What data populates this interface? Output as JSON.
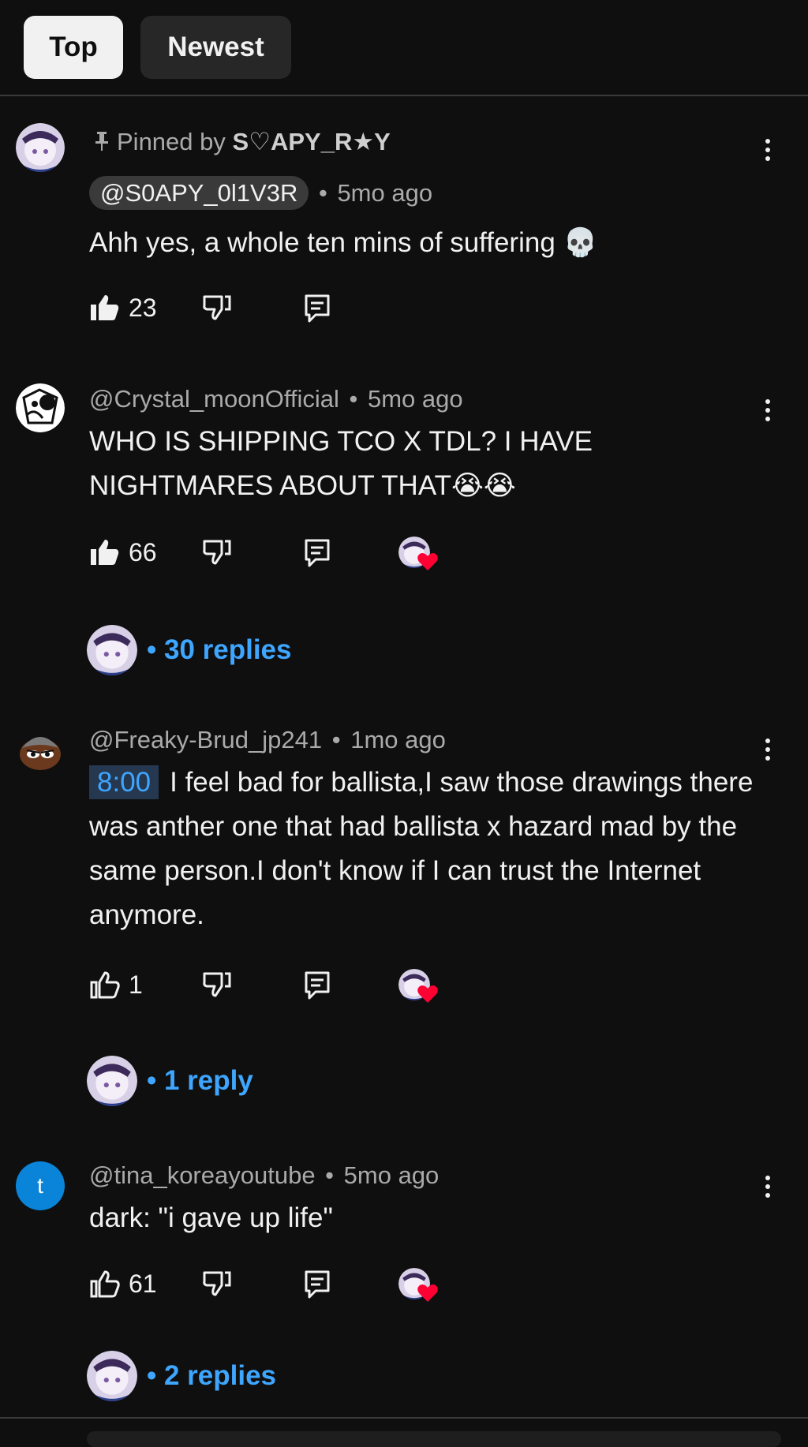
{
  "sort": {
    "top_label": "Top",
    "newest_label": "Newest"
  },
  "comments": [
    {
      "pinned_text": "Pinned by",
      "pinned_by": "S♡APY_R★Y",
      "author": "@S0APY_0l1V3R",
      "time": "5mo ago",
      "text": "Ahh yes, a whole ten mins of suffering 💀",
      "likes": "23"
    },
    {
      "author": "@Crystal_moonOfficial",
      "time": "5mo ago",
      "text": "WHO IS SHIPPING TCO X TDL? I HAVE NIGHTMARES ABOUT THAT😭😭",
      "likes": "66",
      "replies": "30 replies"
    },
    {
      "author": "@Freaky-Brud_jp241",
      "time": "1mo ago",
      "timestamp": "8:00",
      "text": "I feel bad for ballista,I saw those drawings there was anther one that had ballista x hazard mad by the same person.I don't know if I can trust the Internet anymore.",
      "likes": "1",
      "replies": "1 reply"
    },
    {
      "author": "@tina_koreayoutube",
      "avatar_letter": "t",
      "time": "5mo ago",
      "text": "dark: \"i gave up life\"",
      "likes": "61",
      "replies": "2 replies"
    }
  ],
  "colors": {
    "background": "#0f0f0f",
    "link": "#3ea6ff",
    "secondary_text": "#aaaaaa",
    "heart": "#ff0033"
  },
  "icons": [
    "pin-icon",
    "like-icon",
    "dislike-icon",
    "reply-icon",
    "more-vert-icon",
    "heart-icon"
  ]
}
